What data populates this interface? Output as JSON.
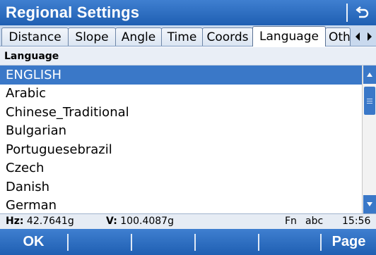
{
  "window": {
    "title": "Regional Settings",
    "back_icon": "back-arrow-icon"
  },
  "tabs": [
    {
      "label": "Distance",
      "active": false
    },
    {
      "label": "Slope",
      "active": false
    },
    {
      "label": "Angle",
      "active": false
    },
    {
      "label": "Time",
      "active": false
    },
    {
      "label": "Coords",
      "active": false
    },
    {
      "label": "Language",
      "active": true
    },
    {
      "label": "Oth",
      "active": false
    }
  ],
  "tab_scroll": {
    "left_icon": "triangle-left-icon",
    "right_icon": "triangle-right-icon"
  },
  "list": {
    "header": "Language",
    "selected": "ENGLISH",
    "items": [
      "ENGLISH",
      "Arabic",
      "Chinese_Traditional",
      "Bulgarian",
      "Portuguesebrazil",
      "Czech",
      "Danish",
      "German"
    ]
  },
  "status": {
    "hz_label": "Hz:",
    "hz_value": "42.7641g",
    "v_label": "V:",
    "v_value": "100.4087g",
    "fn": "Fn",
    "input_mode": "abc",
    "time": "15:56"
  },
  "softkeys": {
    "ok": "OK",
    "page": "Page"
  },
  "colors": {
    "accent": "#3a78c8",
    "titlebar": "#2a6cc0",
    "selection_text": "#ffffff"
  }
}
